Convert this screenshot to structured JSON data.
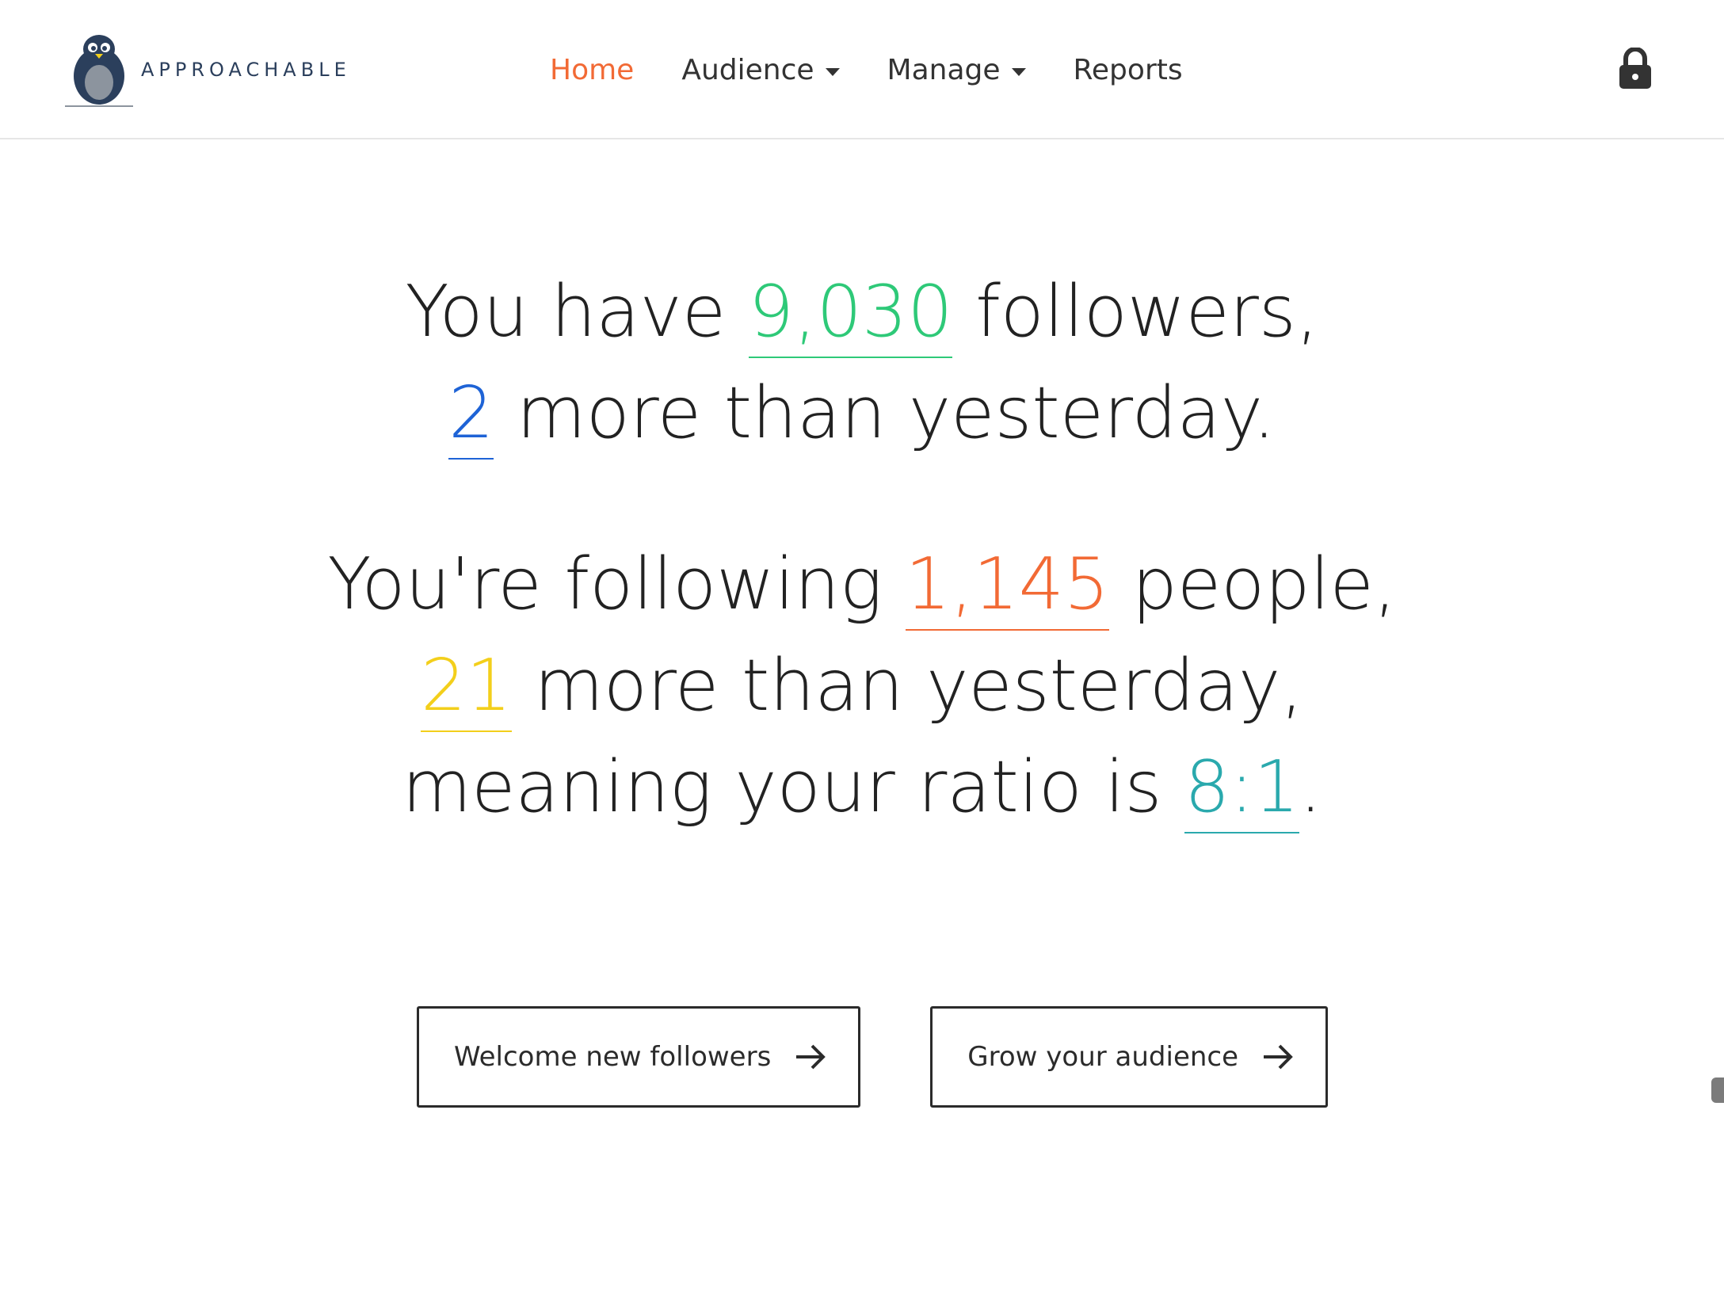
{
  "brand": {
    "name": "APPROACHABLE",
    "logo_icon": "penguin-icon"
  },
  "nav": {
    "items": [
      {
        "label": "Home",
        "active": true,
        "has_dropdown": false
      },
      {
        "label": "Audience",
        "active": false,
        "has_dropdown": true
      },
      {
        "label": "Manage",
        "active": false,
        "has_dropdown": true
      },
      {
        "label": "Reports",
        "active": false,
        "has_dropdown": false
      }
    ],
    "lock_icon": "lock-icon"
  },
  "stats": {
    "followers": {
      "prefix": "You have",
      "value": "9,030",
      "suffix": "followers,",
      "delta": "2",
      "delta_suffix": "more than yesterday."
    },
    "following": {
      "prefix": "You're following",
      "value": "1,145",
      "suffix": "people,",
      "delta": "21",
      "delta_suffix": "more than yesterday,",
      "ratio_prefix": "meaning your ratio is",
      "ratio": "8:1",
      "ratio_suffix": "."
    }
  },
  "buttons": {
    "welcome": {
      "label": "Welcome new followers",
      "icon": "arrow-right-icon"
    },
    "grow": {
      "label": "Grow your audience",
      "icon": "arrow-right-icon"
    }
  },
  "colors": {
    "accent": "#f26a35",
    "followers": "#2ec978",
    "followers_delta": "#1e63d6",
    "following": "#f26a35",
    "following_delta": "#f3cf1b",
    "ratio": "#2aa9ad",
    "brand_text": "#2b3f5c"
  }
}
